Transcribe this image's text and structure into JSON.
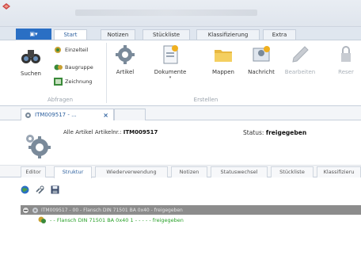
{
  "ribbon": {
    "file_tab": "",
    "tabs": [
      {
        "label": "Start",
        "active": true
      },
      {
        "label": "Notizen",
        "active": false
      },
      {
        "label": "Stückliste",
        "active": false
      },
      {
        "label": "Klassifizierung",
        "active": false
      },
      {
        "label": "Extra",
        "active": false
      }
    ],
    "search": {
      "suchen": "Suchen",
      "einzelteil": "Einzelteil",
      "baugruppe": "Baugruppe",
      "zeichnung": "Zeichnung"
    },
    "create": {
      "artikel": "Artikel",
      "dokumente": "Dokumente",
      "mappen": "Mappen",
      "nachricht": "Nachricht",
      "bearbeiten": "Bearbeiten",
      "reservieren": "Reser"
    },
    "group_abfragen": "Abfragen",
    "group_erstellen": "Erstellen"
  },
  "doc_tab": {
    "label": "ITM009517 - ...",
    "close": "×"
  },
  "header": {
    "prefix": "Alle Artikel Artikelnr.:",
    "number": "ITM009517",
    "status_label": "Status:",
    "status_value": "freigegeben"
  },
  "subtabs": [
    {
      "label": "Editor",
      "active": false
    },
    {
      "label": "Struktur",
      "active": true
    },
    {
      "label": "Wiederverwendung",
      "active": false
    },
    {
      "label": "Notizen",
      "active": false
    },
    {
      "label": "Statuswechsel",
      "active": false
    },
    {
      "label": "Stückliste",
      "active": false
    },
    {
      "label": "Klassifizieru",
      "active": false
    }
  ],
  "tree": {
    "root": "ITM009517 - 00 - Flansch DIN 71501 BA 0x40 - freigegeben",
    "child": "- - Flansch DIN 71501 BA 0x40 1 - - - - - freigegeben"
  },
  "colors": {
    "accent": "#2a6fc4",
    "tab_text": "#2b5f9e",
    "child_text": "#28a028",
    "root_row": "#8c8c8c"
  }
}
